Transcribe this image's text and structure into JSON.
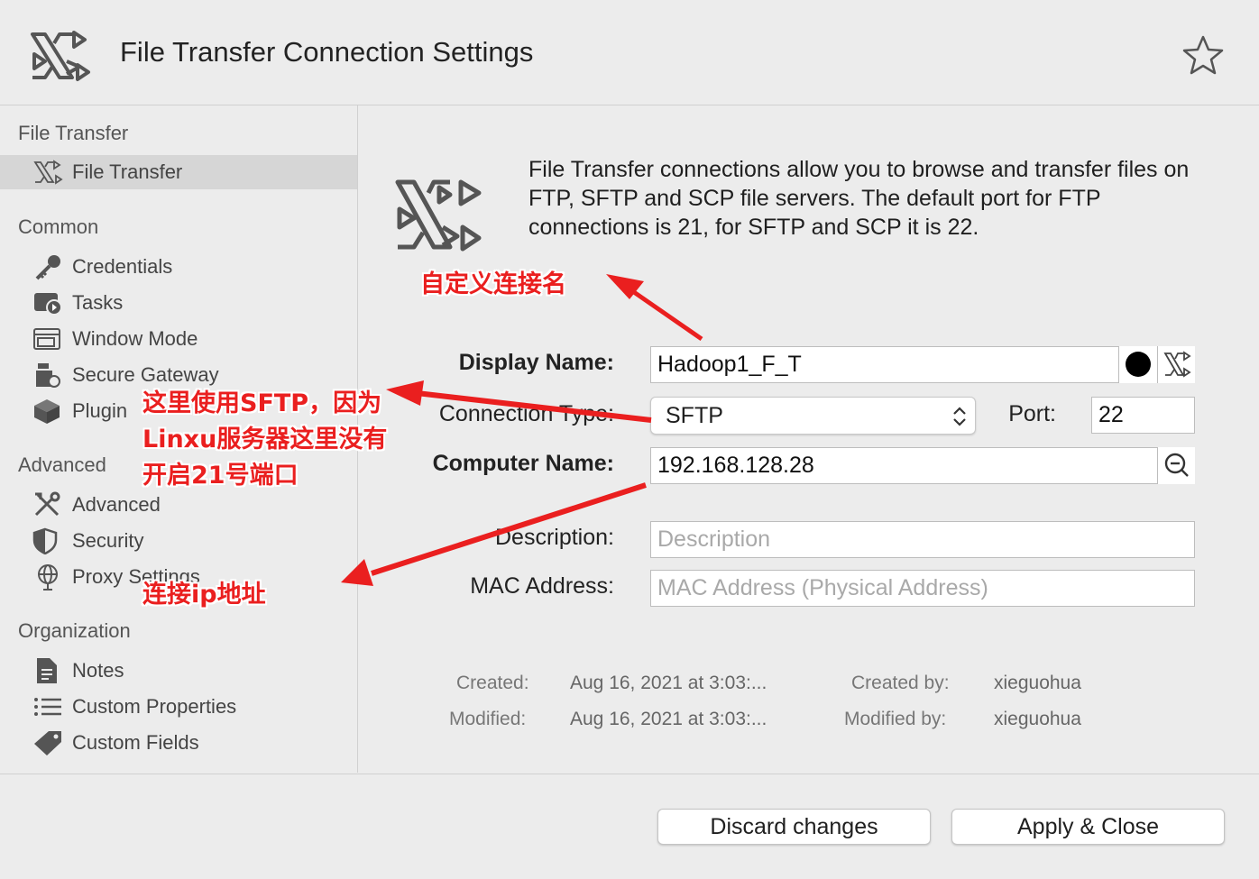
{
  "header": {
    "title": "File Transfer Connection Settings",
    "logo_icon": "file-transfer-icon",
    "favorite_icon": "star-icon"
  },
  "sidebar": {
    "sections": [
      {
        "title": "File Transfer",
        "items": [
          {
            "label": "File Transfer",
            "icon": "file-transfer-icon",
            "selected": true
          }
        ]
      },
      {
        "title": "Common",
        "items": [
          {
            "label": "Credentials",
            "icon": "key-icon"
          },
          {
            "label": "Tasks",
            "icon": "tasks-icon"
          },
          {
            "label": "Window Mode",
            "icon": "window-icon"
          },
          {
            "label": "Secure Gateway",
            "icon": "gateway-icon"
          },
          {
            "label": "Plugin",
            "icon": "plugin-icon"
          }
        ]
      },
      {
        "title": "Advanced",
        "items": [
          {
            "label": "Advanced",
            "icon": "tools-icon"
          },
          {
            "label": "Security",
            "icon": "shield-icon"
          },
          {
            "label": "Proxy Settings",
            "icon": "globe-icon"
          }
        ]
      },
      {
        "title": "Organization",
        "items": [
          {
            "label": "Notes",
            "icon": "notes-icon"
          },
          {
            "label": "Custom Properties",
            "icon": "list-icon"
          },
          {
            "label": "Custom Fields",
            "icon": "tag-icon"
          }
        ]
      }
    ]
  },
  "main": {
    "intro": "File Transfer connections allow you to browse and transfer files on FTP, SFTP and SCP file servers. The default port for FTP connections is 21, for SFTP and SCP it is 22.",
    "form": {
      "display_name_label": "Display Name:",
      "display_name_value": "Hadoop1_F_T",
      "connection_type_label": "Connection Type:",
      "connection_type_value": "SFTP",
      "port_label": "Port:",
      "port_value": "22",
      "computer_name_label": "Computer Name:",
      "computer_name_value": "192.168.128.28",
      "description_label": "Description:",
      "description_placeholder": "Description",
      "mac_label": "MAC Address:",
      "mac_placeholder": "MAC Address (Physical Address)"
    },
    "meta": {
      "created_label": "Created:",
      "created_value": "Aug 16, 2021 at 3:03:...",
      "created_by_label": "Created by:",
      "created_by_value": "xieguohua",
      "modified_label": "Modified:",
      "modified_value": "Aug 16, 2021 at 3:03:...",
      "modified_by_label": "Modified by:",
      "modified_by_value": "xieguohua"
    }
  },
  "footer": {
    "discard_label": "Discard changes",
    "apply_label": "Apply & Close"
  },
  "annotations": {
    "custom_name": "自定义连接名",
    "sftp_line1": "这里使用SFTP，因为",
    "sftp_line2": "Linxu服务器这里没有",
    "sftp_line3": "开启21号端口",
    "ip_address": "连接ip地址"
  },
  "colors": {
    "annotation": "#ea1f1f",
    "background": "#ececec",
    "selected_row": "#d6d6d6"
  }
}
